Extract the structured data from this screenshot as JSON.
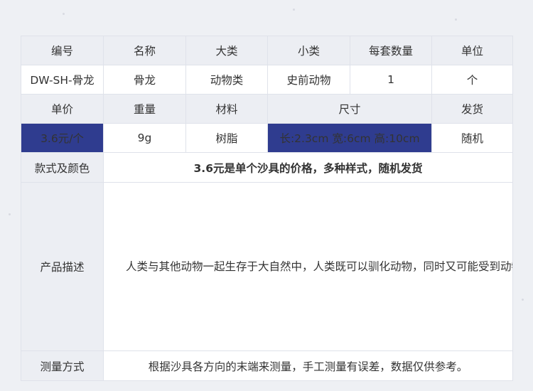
{
  "row1": [
    "编号",
    "名称",
    "大类",
    "小类",
    "每套数量",
    "单位"
  ],
  "row2": [
    "DW-SH-骨龙",
    "骨龙",
    "动物类",
    "史前动物",
    "1",
    "个"
  ],
  "row3": [
    "单价",
    "重量",
    "材料",
    "尺寸",
    "发货"
  ],
  "row4": [
    "3.6元/个",
    "9g",
    "树脂",
    "长:2.3cm 宽:6cm 高:10cm",
    "随机"
  ],
  "style": {
    "label": "款式及颜色",
    "value": "3.6元是单个沙具的价格，多种样式，随机发货"
  },
  "description": {
    "label": "产品描述",
    "text": "人类与其他动物一起生存于大自然中，人类既可以驯化动物，同时又可能受到动物的威胁和伤害，动物对人类而言，是敌也是友。自古至今，人类历经千百万年的历史，对不同的动物都形成了一些普遍的认识。动物在所有文化群体中，经常是最直接、最有力、最重要的象征源泉，几乎所有的人类品质都能用某些动物来表现。许多原始文化中，人们都对动物非常敬畏，认为这些动物与宇宙能量息息相关。动物优于人类的身体素质和感官能力，这使人们更加确信它们具有某些神奇的精神力量，而人类则通过对这些动物的祭祀仪式获得此种力量，将某种动物作为民族的图腾，或用某种动物来象征自己。"
  },
  "measure": {
    "label": "测量方式",
    "value": "根据沙具各方向的末端来测量，手工测量有误差，数据仅供参考。"
  },
  "colors": {
    "accent": "#2f3c8f",
    "header_bg": "#eceef3",
    "page_bg": "#eef0f4",
    "border": "#dfe2ea"
  }
}
